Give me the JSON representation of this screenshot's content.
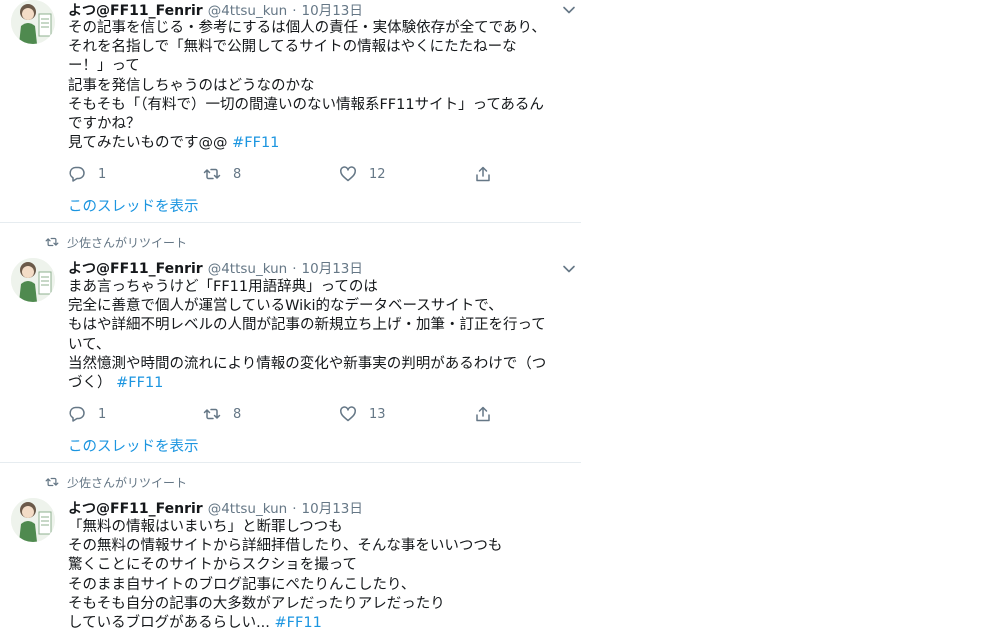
{
  "tweets": [
    {
      "retweeter_line": "",
      "name": "よつ@FF11_Fenrir",
      "handle": "@4ttsu_kun",
      "dot": "·",
      "time": "10月13日",
      "lines": [
        "その記事を信じる・参考にするは個人の責任・実体験依存が全てであり、",
        "それを名指しで「無料で公開してるサイトの情報はやくにたたねーな",
        "ー！」って",
        "記事を発信しちゃうのはどうなのかな",
        "そもそも「（有料で）一切の間違いのない情報系FF11サイト」ってあるん",
        "ですかね？",
        "見てみたいものです@@"
      ],
      "hashtag": "#FF11",
      "reply_count": "1",
      "retweet_count": "8",
      "like_count": "12",
      "thread_link": "このスレッドを表示"
    },
    {
      "retweeter_line": "少佐さんがリツイート",
      "name": "よつ@FF11_Fenrir",
      "handle": "@4ttsu_kun",
      "dot": "·",
      "time": "10月13日",
      "lines": [
        "まあ言っちゃうけど「FF11用語辞典」ってのは",
        "完全に善意で個人が運営しているWiki的なデータベースサイトで、",
        "もはや詳細不明レベルの人間が記事の新規立ち上げ・加筆・訂正を行って",
        "いて、",
        "当然憶測や時間の流れにより情報の変化や新事実の判明があるわけで（つ",
        "づく）"
      ],
      "hashtag": "#FF11",
      "reply_count": "1",
      "retweet_count": "8",
      "like_count": "13",
      "thread_link": "このスレッドを表示"
    },
    {
      "retweeter_line": "少佐さんがリツイート",
      "name": "よつ@FF11_Fenrir",
      "handle": "@4ttsu_kun",
      "dot": "·",
      "time": "10月13日",
      "lines": [
        "「無料の情報はいまいち」と断罪しつつも",
        "その無料の情報サイトから詳細拝借したり、そんな事をいいつつも",
        "驚くことにそのサイトからスクショを撮って",
        "そのまま自サイトのブログ記事にぺたりんこしたり、",
        "そもそも自分の記事の大多数がアレだったりアレだったり",
        "しているブログがあるらしい..."
      ],
      "hashtag": "#FF11",
      "reply_count": "",
      "retweet_count": "",
      "like_count": "",
      "thread_link": ""
    }
  ],
  "colors": {
    "text": "#14171a",
    "secondary": "#657786",
    "link": "#1b95e0",
    "divider": "#e6ecf0"
  },
  "icons": {
    "reply": "reply-icon",
    "retweet": "retweet-icon",
    "like": "heart-icon",
    "share": "share-icon",
    "caret": "chevron-down-icon",
    "retweeted": "retweet-indicator-icon"
  }
}
